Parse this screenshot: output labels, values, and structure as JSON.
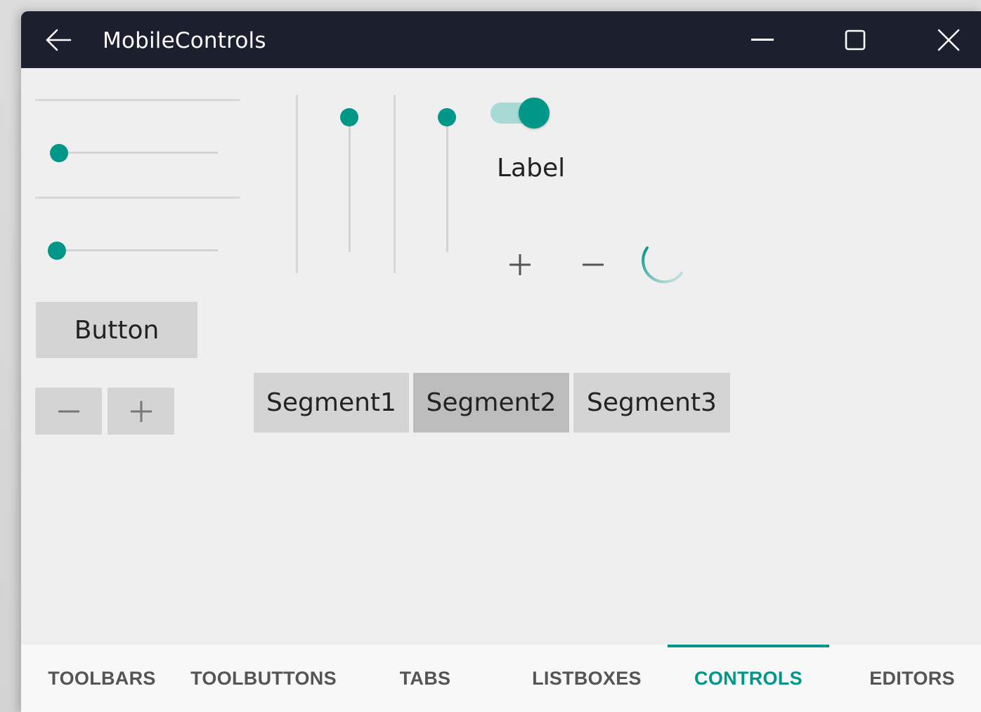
{
  "window": {
    "title": "MobileControls"
  },
  "controls": {
    "label_text": "Label",
    "button_label": "Button",
    "stepper_minus": "−",
    "stepper_plus": "+",
    "spin_plus": "+",
    "spin_minus": "−",
    "switch_on": true,
    "segments": [
      "Segment1",
      "Segment2",
      "Segment3"
    ],
    "selected_segment": "Segment2"
  },
  "tabs": [
    {
      "label": "TOOLBARS",
      "active": false
    },
    {
      "label": "TOOLBUTTONS",
      "active": false
    },
    {
      "label": "TABS",
      "active": false
    },
    {
      "label": "LISTBOXES",
      "active": false
    },
    {
      "label": "CONTROLS",
      "active": true
    },
    {
      "label": "EDITORS",
      "active": false
    }
  ],
  "colors": {
    "accent": "#009688",
    "titlebar": "#1c1f2d",
    "background": "#efefef"
  },
  "icons": {
    "back": "back-arrow-icon",
    "minimize": "minimize-icon",
    "maximize": "maximize-icon",
    "close": "close-icon",
    "spinner": "loading-spinner-icon"
  }
}
